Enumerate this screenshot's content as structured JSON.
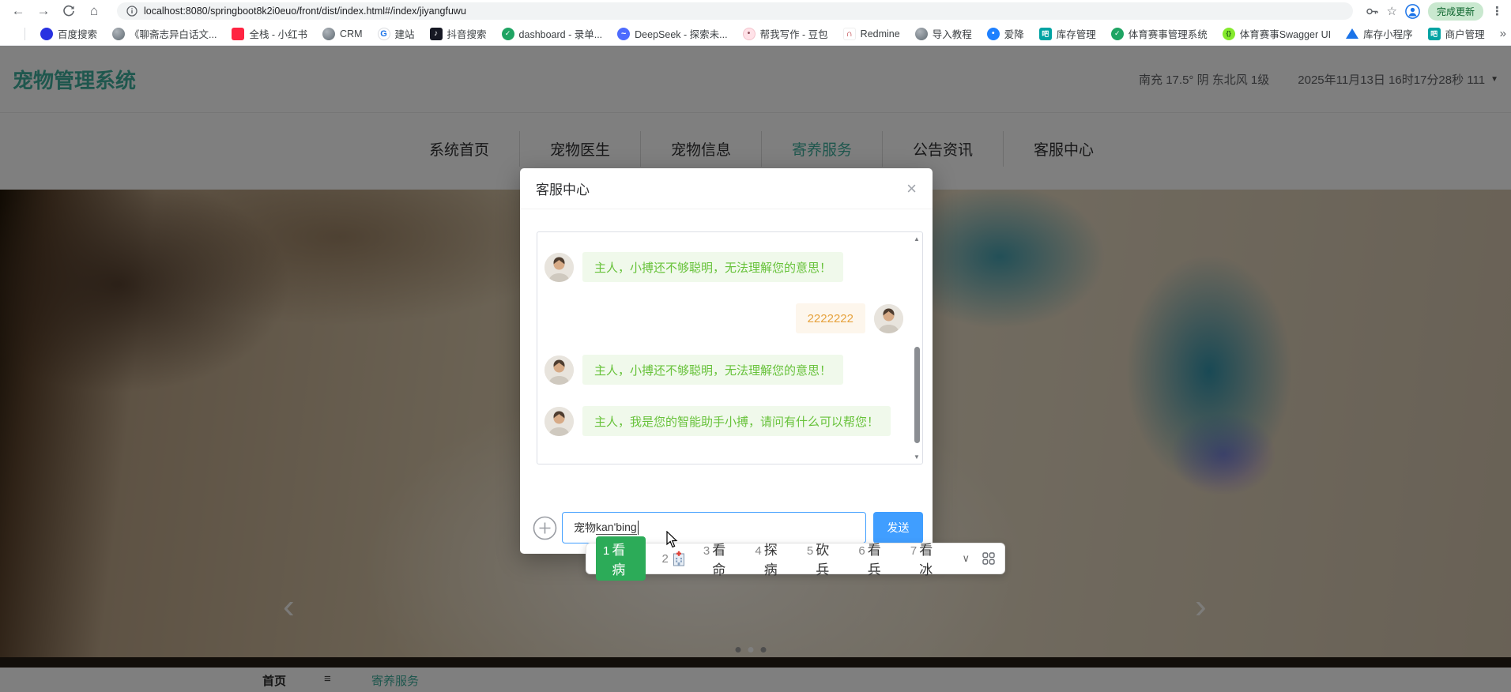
{
  "browser": {
    "url": "localhost:8080/springboot8k2i0euo/front/dist/index.html#/index/jiyangfuwu",
    "update_label": "完成更新",
    "overflow": "»",
    "bookmarks": [
      {
        "label": "百度搜索",
        "icon": "baidu"
      },
      {
        "label": "《聊斋志异白话文...",
        "icon": "globe"
      },
      {
        "label": "全栈 - 小红书",
        "icon": "xhs"
      },
      {
        "label": "CRM",
        "icon": "globe"
      },
      {
        "label": "建站",
        "icon": "gsite"
      },
      {
        "label": "抖音搜索",
        "icon": "tiktok"
      },
      {
        "label": "dashboard - 录单...",
        "icon": "greenv"
      },
      {
        "label": "DeepSeek - 探索未...",
        "icon": "deepseek"
      },
      {
        "label": "帮我写作 - 豆包",
        "icon": "doubao"
      },
      {
        "label": "Redmine",
        "icon": "redmine"
      },
      {
        "label": "导入教程",
        "icon": "globe"
      },
      {
        "label": "爱降",
        "icon": "aijiang"
      },
      {
        "label": "库存管理",
        "icon": "teal"
      },
      {
        "label": "体育赛事管理系统",
        "icon": "greenv"
      },
      {
        "label": "体育赛事Swagger UI",
        "icon": "swagger"
      },
      {
        "label": "库存小程序",
        "icon": "tri"
      },
      {
        "label": "商户管理",
        "icon": "teal"
      }
    ]
  },
  "header": {
    "title": "宠物管理系统",
    "weather": "南充 17.5° 阴 东北风 1级",
    "datetime": "2025年11月13日 16时17分28秒 111",
    "caret": "▼"
  },
  "nav": {
    "items": [
      {
        "label": "系统首页",
        "active": false
      },
      {
        "label": "宠物医生",
        "active": false
      },
      {
        "label": "宠物信息",
        "active": false
      },
      {
        "label": "寄养服务",
        "active": true
      },
      {
        "label": "公告资讯",
        "active": false
      },
      {
        "label": "客服中心",
        "active": false
      }
    ]
  },
  "carousel": {
    "prev": "‹",
    "next": "›",
    "dots": [
      {
        "active": false
      },
      {
        "active": true
      },
      {
        "active": false
      }
    ]
  },
  "footer": {
    "home": "首页",
    "menu_icon": "≡",
    "active_item": "寄养服务"
  },
  "modal": {
    "title": "客服中心",
    "close": "×",
    "scroll_up": "▲",
    "scroll_down": "▼",
    "messages": [
      {
        "from": "bot",
        "text": "主人，小搏还不够聪明，无法理解您的意思！"
      },
      {
        "from": "user",
        "text": "2222222"
      },
      {
        "from": "bot",
        "text": "主人，小搏还不够聪明，无法理解您的意思！"
      },
      {
        "from": "bot",
        "text": "主人，我是您的智能助手小搏，请问有什么可以帮您！"
      }
    ],
    "input": {
      "typed": "宠物",
      "composition": "kan'bing"
    },
    "send_label": "发送"
  },
  "ime": {
    "candidates": [
      {
        "index": "1",
        "text": "看病",
        "selected": true
      },
      {
        "index": "2",
        "text": "",
        "icon": "hospital-emoji"
      },
      {
        "index": "3",
        "text": "看命"
      },
      {
        "index": "4",
        "text": "探病"
      },
      {
        "index": "5",
        "text": "砍兵"
      },
      {
        "index": "6",
        "text": "看兵"
      },
      {
        "index": "7",
        "text": "看冰"
      }
    ],
    "chevron": "∨"
  },
  "colors": {
    "accent_teal": "#3fae9c",
    "primary_blue": "#409eff",
    "bubble_green_text": "#67c23a",
    "bubble_green_bg": "#f0f9eb",
    "bubble_orange_text": "#e6a23c",
    "bubble_orange_bg": "#fdf6ec",
    "ime_green": "#2cab58"
  }
}
